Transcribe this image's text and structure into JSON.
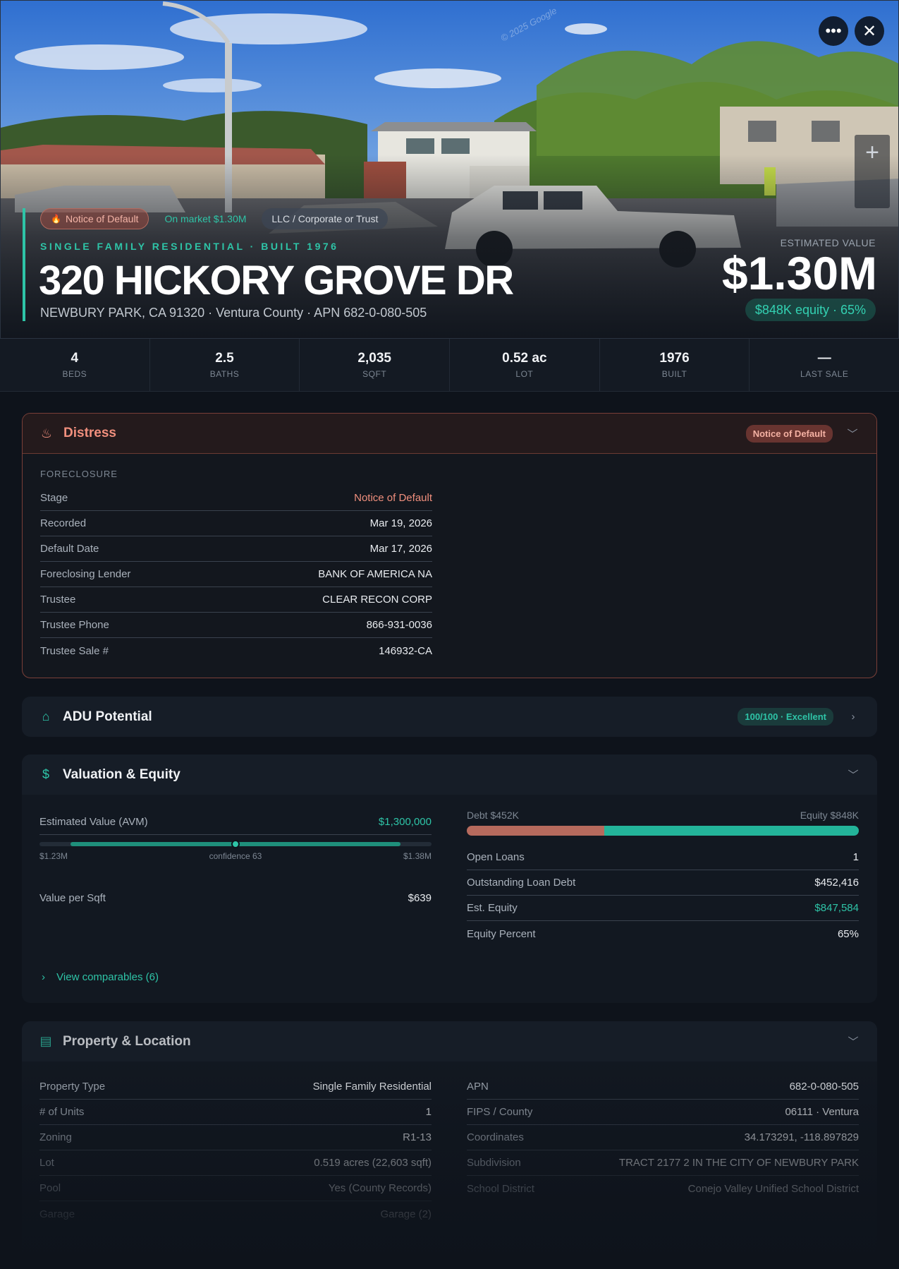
{
  "hero": {
    "watermark": "© 2025 Google",
    "chips": {
      "distress": "Notice of Default",
      "market": "On market $1.30M",
      "owner": "LLC / Corporate or Trust"
    },
    "subtitle": "SINGLE FAMILY RESIDENTIAL · BUILT 1976",
    "address": "320 HICKORY GROVE DR",
    "location": "NEWBURY PARK, CA 91320 · Ventura County · APN 682-0-080-505",
    "estimated_label": "ESTIMATED VALUE",
    "estimated_value": "$1.30M",
    "equity_pill": "$848K equity · 65%"
  },
  "stats": [
    {
      "value": "4",
      "label": "BEDS"
    },
    {
      "value": "2.5",
      "label": "BATHS"
    },
    {
      "value": "2,035",
      "label": "SQFT"
    },
    {
      "value": "0.52 ac",
      "label": "LOT"
    },
    {
      "value": "1976",
      "label": "BUILT"
    },
    {
      "value": "—",
      "label": "LAST SALE"
    }
  ],
  "distress": {
    "title": "Distress",
    "badge": "Notice of Default",
    "section_label": "FORECLOSURE",
    "rows": [
      {
        "k": "Stage",
        "v": "Notice of Default"
      },
      {
        "k": "Recorded",
        "v": "Mar 19, 2026"
      },
      {
        "k": "Default Date",
        "v": "Mar 17, 2026"
      },
      {
        "k": "Foreclosing Lender",
        "v": "BANK OF AMERICA NA"
      },
      {
        "k": "Trustee",
        "v": "CLEAR RECON CORP"
      },
      {
        "k": "Trustee Phone",
        "v": "866-931-0036"
      },
      {
        "k": "Trustee Sale #",
        "v": "146932-CA"
      }
    ]
  },
  "adu": {
    "title": "ADU Potential",
    "badge": "100/100 · Excellent"
  },
  "valuation": {
    "title": "Valuation & Equity",
    "avm_label": "Estimated Value (AVM)",
    "avm_value": "$1,300,000",
    "range_low": "$1.23M",
    "range_high": "$1.38M",
    "confidence": "confidence 63",
    "range_fill": {
      "start": 0.08,
      "end": 0.92
    },
    "avm_position": 0.5,
    "vps_label": "Value per Sqft",
    "vps_value": "$639",
    "debt_label": "Debt $452K",
    "equity_label": "Equity $848K",
    "debt_fraction": 0.35,
    "loans": [
      {
        "k": "Open Loans",
        "v": "1"
      },
      {
        "k": "Outstanding Loan Debt",
        "v": "$452,416"
      },
      {
        "k": "Est. Equity",
        "v": "$847,584"
      },
      {
        "k": "Equity Percent",
        "v": "65%"
      }
    ],
    "view_comps": "View comparables (6)"
  },
  "property": {
    "title": "Property & Location",
    "left": [
      {
        "k": "Property Type",
        "v": "Single Family Residential"
      },
      {
        "k": "# of Units",
        "v": "1"
      },
      {
        "k": "Zoning",
        "v": "R1-13"
      },
      {
        "k": "Lot",
        "v": "0.519 acres (22,603 sqft)"
      },
      {
        "k": "Pool",
        "v": "Yes (County Records)"
      },
      {
        "k": "Garage",
        "v": "Garage (2)"
      }
    ],
    "right": [
      {
        "k": "APN",
        "v": "682-0-080-505"
      },
      {
        "k": "FIPS / County",
        "v": "06111 · Ventura"
      },
      {
        "k": "Coordinates",
        "v": "34.173291, -118.897829"
      },
      {
        "k": "Subdivision",
        "v": "TRACT 2177 2 IN THE CITY OF NEWBURY PARK"
      },
      {
        "k": "School District",
        "v": "Conejo Valley Unified School District"
      }
    ]
  },
  "colors": {
    "accent": "#2ec4a7",
    "distress": "#f08f7d",
    "debt": "#b66a5d",
    "background": "#0e131b"
  }
}
